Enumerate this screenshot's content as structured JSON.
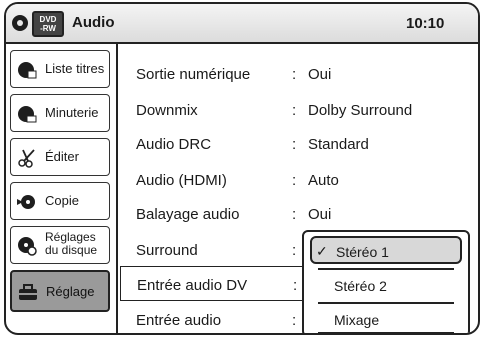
{
  "header": {
    "badge_line1": "DVD",
    "badge_line2": "-RW",
    "title": "Audio",
    "clock": "10:10"
  },
  "sidebar": {
    "items": [
      {
        "label": "Liste titres",
        "icon": "list-icon"
      },
      {
        "label": "Minuterie",
        "icon": "timer-icon"
      },
      {
        "label": "Éditer",
        "icon": "scissors-icon"
      },
      {
        "label": "Copie",
        "icon": "copy-icon"
      },
      {
        "label_line1": "Réglages",
        "label_line2": "du disque",
        "icon": "disc-settings-icon"
      },
      {
        "label": "Réglage",
        "icon": "toolbox-icon",
        "active": true
      }
    ]
  },
  "settings": {
    "rows": [
      {
        "name": "Sortie numérique",
        "colon": ":",
        "value": "Oui"
      },
      {
        "name": "Downmix",
        "colon": ":",
        "value": "Dolby Surround"
      },
      {
        "name": "Audio DRC",
        "colon": ":",
        "value": "Standard"
      },
      {
        "name": "Audio (HDMI)",
        "colon": ":",
        "value": "Auto"
      },
      {
        "name": "Balayage audio",
        "colon": ":",
        "value": "Oui"
      },
      {
        "name": "Surround",
        "colon": ":",
        "value": ""
      },
      {
        "name": "Entrée audio DV",
        "colon": ":",
        "value": "",
        "selected": true
      },
      {
        "name": "Entrée audio",
        "colon": ":",
        "value": ""
      }
    ]
  },
  "dropdown": {
    "check_mark": "✓",
    "options": [
      "Stéréo 1",
      "Stéréo 2",
      "Mixage"
    ],
    "selected": "Stéréo 1"
  }
}
